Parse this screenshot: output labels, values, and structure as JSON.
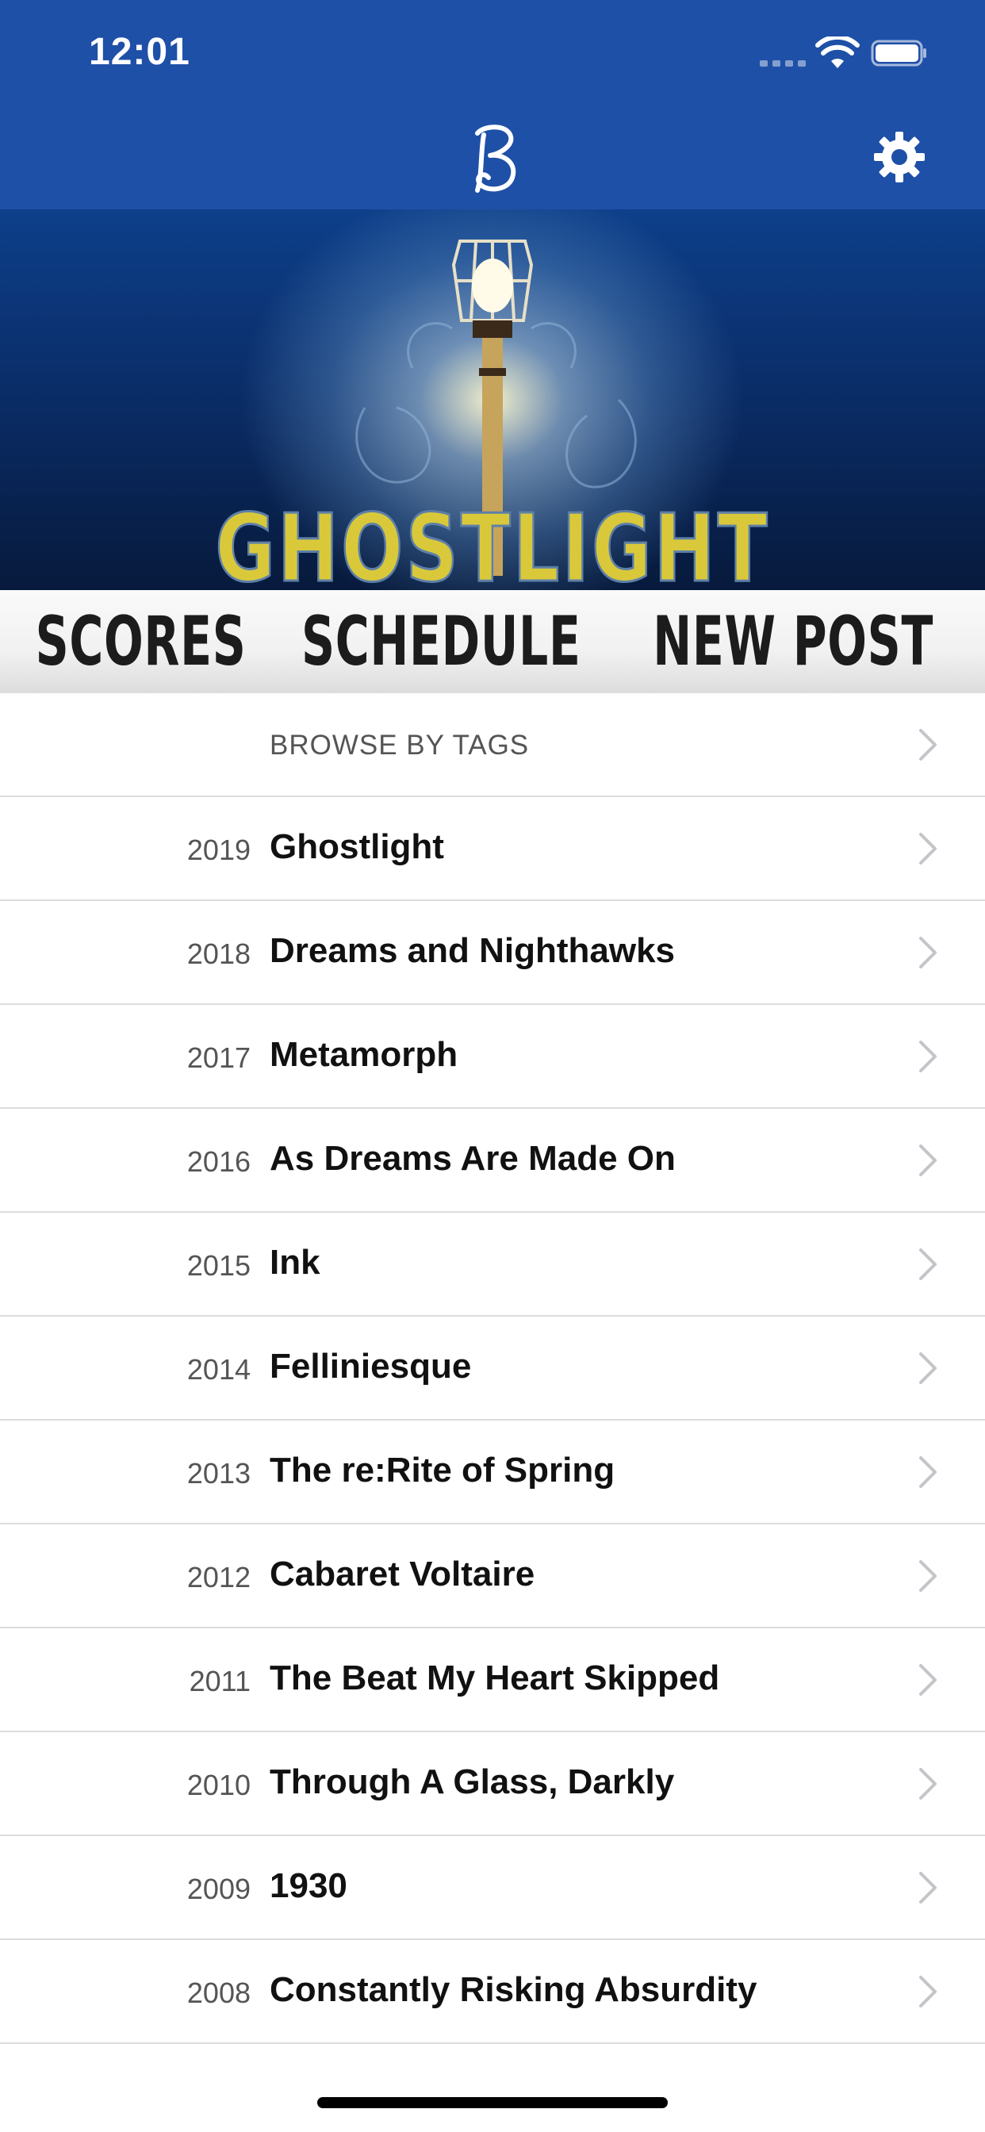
{
  "status_bar": {
    "time": "12:01",
    "background": "#1f50a8"
  },
  "nav": {
    "logo_icon": "b-script-logo-icon",
    "settings_icon": "gear-icon"
  },
  "hero": {
    "title": "GHOSTLIGHT"
  },
  "tabs": [
    {
      "label": "SCORES"
    },
    {
      "label": "SCHEDULE"
    },
    {
      "label": "NEW POST"
    }
  ],
  "list": {
    "browse_label": "BROWSE BY TAGS",
    "items": [
      {
        "year": "2019",
        "title": "Ghostlight"
      },
      {
        "year": "2018",
        "title": "Dreams and Nighthawks"
      },
      {
        "year": "2017",
        "title": "Metamorph"
      },
      {
        "year": "2016",
        "title": "As Dreams Are Made On"
      },
      {
        "year": "2015",
        "title": "Ink"
      },
      {
        "year": "2014",
        "title": "Felliniesque"
      },
      {
        "year": "2013",
        "title": "The re:Rite of Spring"
      },
      {
        "year": "2012",
        "title": "Cabaret Voltaire"
      },
      {
        "year": "2011",
        "title": "The Beat My Heart Skipped"
      },
      {
        "year": "2010",
        "title": "Through A Glass, Darkly"
      },
      {
        "year": "2009",
        "title": "1930"
      },
      {
        "year": "2008",
        "title": "Constantly Risking Absurdity"
      }
    ]
  },
  "colors": {
    "brand_blue": "#1f50a8",
    "chevron": "#c4c4c9"
  }
}
